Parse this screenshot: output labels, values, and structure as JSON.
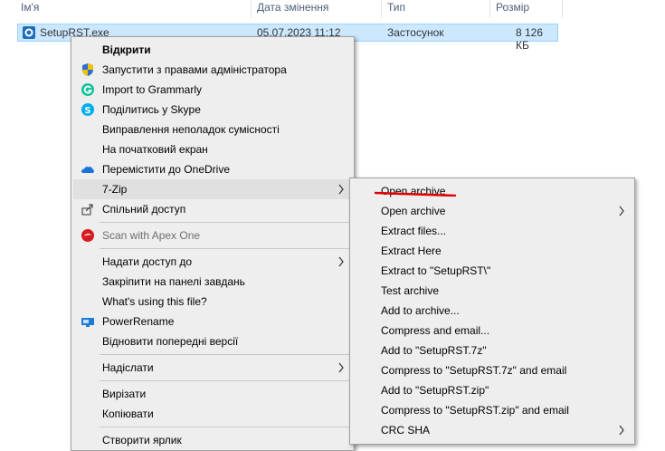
{
  "explorer": {
    "columns": {
      "name": "Ім'я",
      "date": "Дата змінення",
      "type": "Тип",
      "size": "Розмір"
    },
    "file": {
      "name": "SetupRST.exe",
      "date": "05.07.2023 11:12",
      "type": "Застосунок",
      "size": "8 126 КБ"
    }
  },
  "context_menu": {
    "items": [
      {
        "label": "Відкрити",
        "icon": "none"
      },
      {
        "label": "Запустити з правами адміністратора",
        "icon": "shield-icon"
      },
      {
        "label": "Import to Grammarly",
        "icon": "grammarly-icon"
      },
      {
        "label": "Поділитись у Skype",
        "icon": "skype-icon"
      },
      {
        "label": "Виправлення неполадок сумісності",
        "icon": "none"
      },
      {
        "label": "На початковий екран",
        "icon": "none"
      },
      {
        "label": "Перемістити до OneDrive",
        "icon": "onedrive-icon"
      },
      {
        "label": "7-Zip",
        "icon": "none"
      },
      {
        "label": "Спільний доступ",
        "icon": "share-icon"
      },
      {
        "label": "Scan with Apex One",
        "icon": "apex-one-icon"
      },
      {
        "label": "Надати доступ до",
        "icon": "none"
      },
      {
        "label": "Закріпити на панелі завдань",
        "icon": "none"
      },
      {
        "label": "What's using this file?",
        "icon": "none"
      },
      {
        "label": "PowerRename",
        "icon": "powerrename-icon"
      },
      {
        "label": "Відновити попередні версії",
        "icon": "none"
      },
      {
        "label": "Надіслати",
        "icon": "none"
      },
      {
        "label": "Вирізати",
        "icon": "none"
      },
      {
        "label": "Копіювати",
        "icon": "none"
      },
      {
        "label": "Створити ярлик",
        "icon": "none"
      }
    ]
  },
  "submenu_7zip": {
    "items": [
      {
        "label": "Open archive"
      },
      {
        "label": "Open archive"
      },
      {
        "label": "Extract files..."
      },
      {
        "label": "Extract Here"
      },
      {
        "label": "Extract to \"SetupRST\\\""
      },
      {
        "label": "Test archive"
      },
      {
        "label": "Add to archive..."
      },
      {
        "label": "Compress and email..."
      },
      {
        "label": "Add to \"SetupRST.7z\""
      },
      {
        "label": "Compress to \"SetupRST.7z\" and email"
      },
      {
        "label": "Add to \"SetupRST.zip\""
      },
      {
        "label": "Compress to \"SetupRST.zip\" and email"
      },
      {
        "label": "CRC SHA"
      }
    ]
  },
  "colors": {
    "menu_bg": "#eeeeee",
    "selection_bg": "#cce8ff",
    "annotation": "#e00000"
  }
}
